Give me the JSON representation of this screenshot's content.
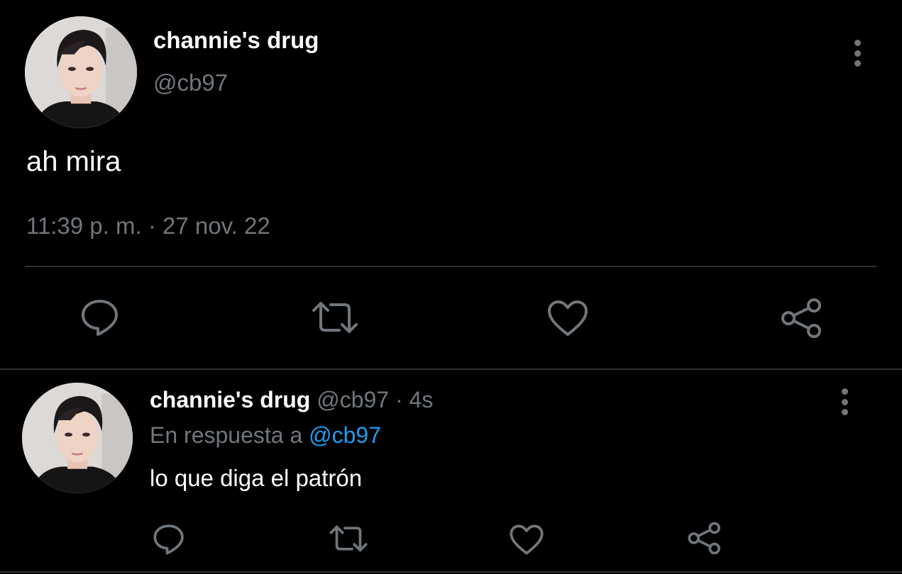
{
  "main_tweet": {
    "display_name": "channie's drug",
    "handle": "@cb97",
    "text": "ah mira",
    "time": "11:39 p. m.",
    "separator": "·",
    "date": "27 nov. 22",
    "actions": [
      "reply-icon",
      "retweet-icon",
      "like-icon",
      "share-icon"
    ]
  },
  "reply_tweet": {
    "display_name": "channie's drug",
    "handle": "@cb97",
    "separator": "·",
    "age": "4s",
    "replying_to_label": "En respuesta a",
    "replying_to_handle": "@cb97",
    "text": "lo que diga el patrón",
    "actions": [
      "reply-icon",
      "retweet-icon",
      "like-icon",
      "share-icon"
    ]
  },
  "colors": {
    "background": "#000000",
    "primary_text": "#ffffff",
    "secondary_text": "#71767b",
    "accent": "#1d9bf0",
    "divider": "#2f3336"
  }
}
